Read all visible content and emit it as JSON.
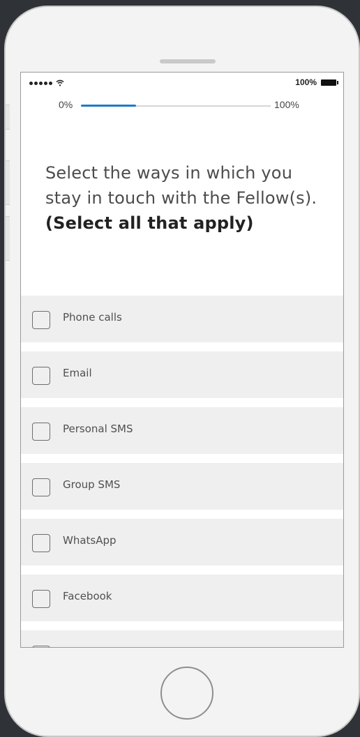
{
  "status_bar": {
    "battery_text": "100%"
  },
  "progress": {
    "min_label": "0%",
    "max_label": "100%",
    "value_percent": 29
  },
  "question": {
    "text": "Select the ways in which you stay in touch with the Fellow(s).",
    "emphasis": "(Select all that apply)"
  },
  "options": [
    {
      "label": "Phone calls",
      "checked": false
    },
    {
      "label": "Email",
      "checked": false
    },
    {
      "label": "Personal SMS",
      "checked": false
    },
    {
      "label": "Group SMS",
      "checked": false
    },
    {
      "label": "WhatsApp",
      "checked": false
    },
    {
      "label": "Facebook",
      "checked": false
    }
  ],
  "colors": {
    "accent": "#1e7ac9",
    "option_bg": "#efefef"
  },
  "icons": {
    "signal": "signal-dots-icon",
    "wifi": "wifi-icon",
    "battery": "battery-icon"
  }
}
